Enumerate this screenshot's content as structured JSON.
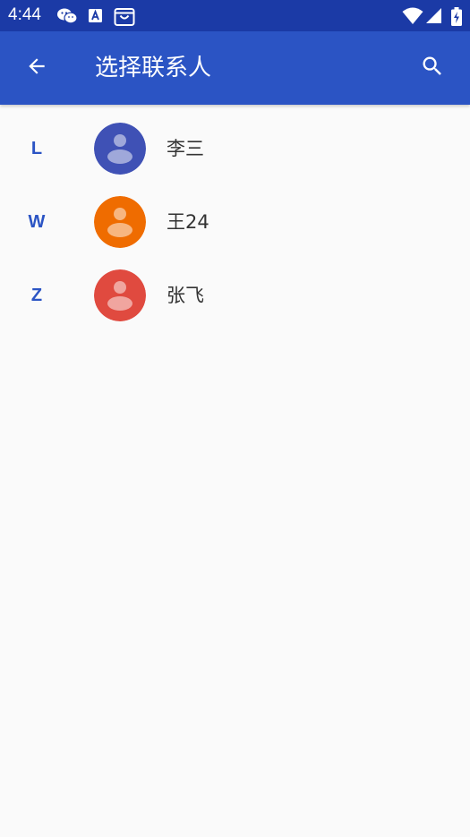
{
  "status_bar": {
    "time": "4:44",
    "left_icons": [
      "wechat-icon",
      "font-a-icon",
      "store-bag-icon"
    ],
    "right_icons": [
      "wifi-icon",
      "cellular-signal-icon",
      "battery-charging-icon"
    ]
  },
  "app_bar": {
    "title": "选择联系人",
    "back_icon": "arrow-back-icon",
    "search_icon": "search-icon"
  },
  "colors": {
    "status_bar": "#1b3aa6",
    "app_bar": "#2b54c4",
    "accent": "#2b54c4",
    "background": "#fafafa",
    "text": "#333333"
  },
  "contacts": [
    {
      "letter": "L",
      "name": "李三",
      "avatar_color": "#3f51b5"
    },
    {
      "letter": "W",
      "name": "王24",
      "avatar_color": "#ef6c00"
    },
    {
      "letter": "Z",
      "name": "张飞",
      "avatar_color": "#e04a3f"
    }
  ]
}
